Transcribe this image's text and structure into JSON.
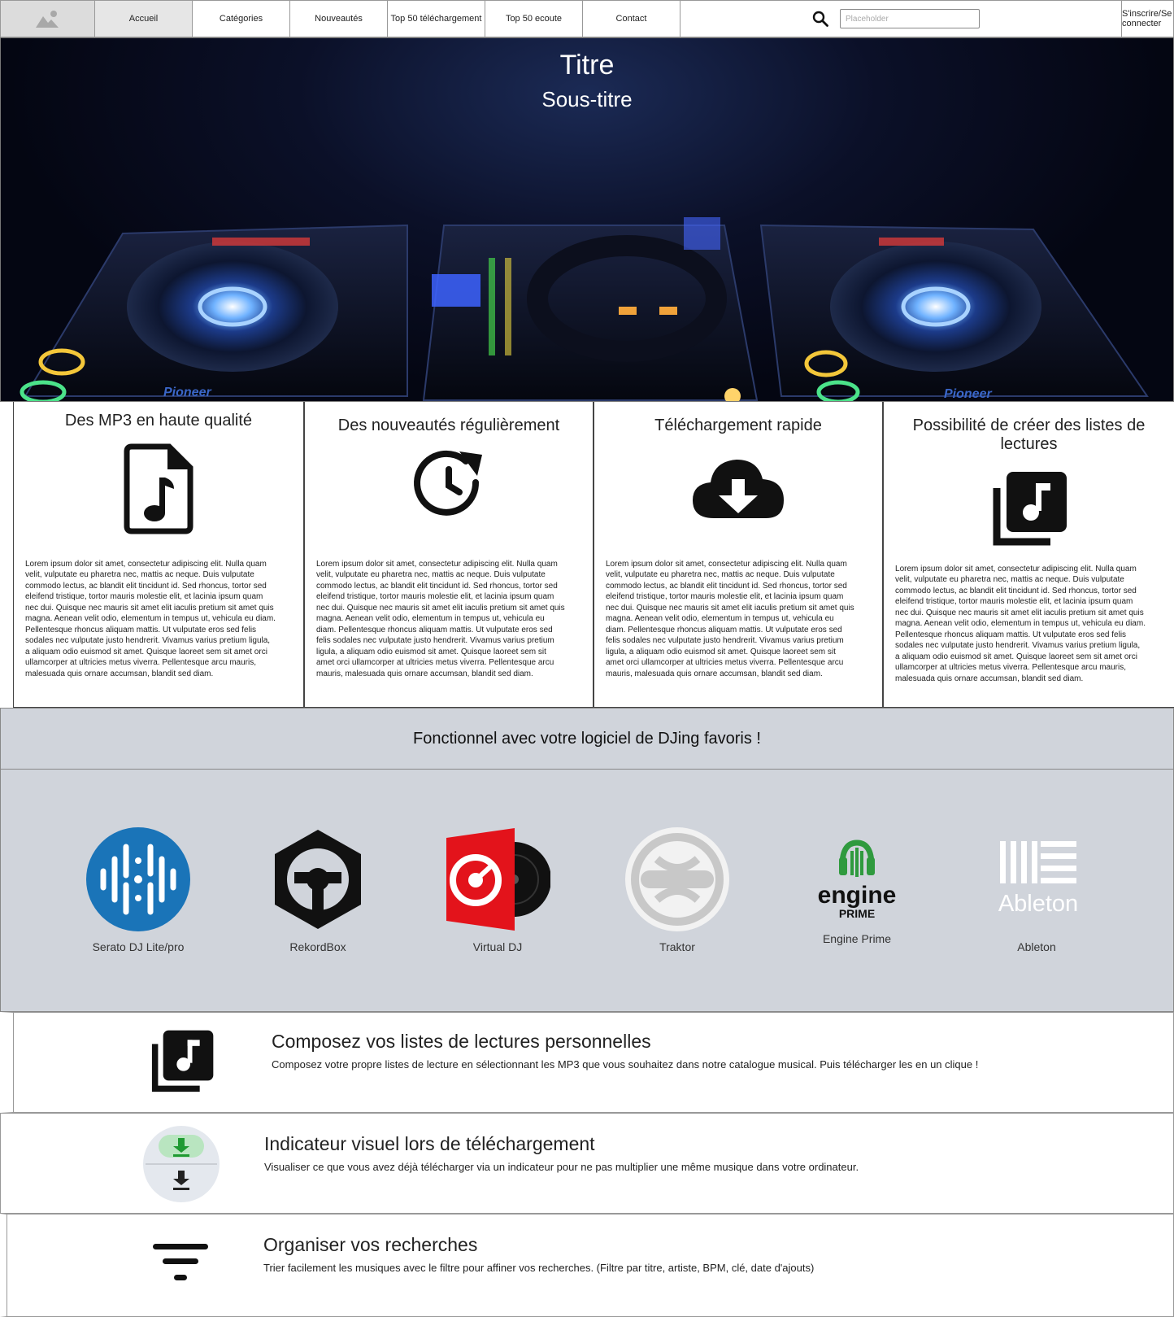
{
  "nav": {
    "tabs": [
      {
        "label": "Accueil",
        "active": true
      },
      {
        "label": "Catégories",
        "active": false
      },
      {
        "label": "Nouveautés",
        "active": false
      },
      {
        "label": "Top 50 téléchargement",
        "active": false
      },
      {
        "label": "Top 50 ecoute",
        "active": false
      },
      {
        "label": "Contact",
        "active": false
      }
    ],
    "search_placeholder": "Placeholder",
    "auth_label": "S'inscrire/Se connecter"
  },
  "hero": {
    "title": "Titre",
    "subtitle": "Sous-titre",
    "deck_labels": {
      "left": "Pioneer",
      "right": "Pioneer"
    }
  },
  "features": [
    {
      "title": "Des MP3 en haute qualité",
      "icon": "music-file-icon",
      "text": "Lorem ipsum dolor sit amet, consectetur adipiscing elit. Nulla quam velit, vulputate eu pharetra nec, mattis ac neque. Duis vulputate commodo lectus, ac blandit elit tincidunt id. Sed rhoncus, tortor sed eleifend tristique, tortor mauris molestie elit, et lacinia ipsum quam nec dui. Quisque nec mauris sit amet elit iaculis pretium sit amet quis magna. Aenean velit odio, elementum in tempus ut, vehicula eu diam. Pellentesque rhoncus aliquam mattis. Ut vulputate eros sed felis sodales nec vulputate justo hendrerit. Vivamus varius pretium ligula, a aliquam odio euismod sit amet. Quisque laoreet sem sit amet orci ullamcorper at ultricies metus viverra. Pellentesque arcu mauris, malesuada quis ornare accumsan, blandit sed diam."
    },
    {
      "title": "Des nouveautés régulièrement",
      "icon": "clock-refresh-icon",
      "text": "Lorem ipsum dolor sit amet, consectetur adipiscing elit. Nulla quam velit, vulputate eu pharetra nec, mattis ac neque. Duis vulputate commodo lectus, ac blandit elit tincidunt id. Sed rhoncus, tortor sed eleifend tristique, tortor mauris molestie elit, et lacinia ipsum quam nec dui. Quisque nec mauris sit amet elit iaculis pretium sit amet quis magna. Aenean velit odio, elementum in tempus ut, vehicula eu diam. Pellentesque rhoncus aliquam mattis. Ut vulputate eros sed felis sodales nec vulputate justo hendrerit. Vivamus varius pretium ligula, a aliquam odio euismod sit amet. Quisque laoreet sem sit amet orci ullamcorper at ultricies metus viverra. Pellentesque arcu mauris, malesuada quis ornare accumsan, blandit sed diam."
    },
    {
      "title": "Téléchargement rapide",
      "icon": "cloud-download-icon",
      "text": "Lorem ipsum dolor sit amet, consectetur adipiscing elit. Nulla quam velit, vulputate eu pharetra nec, mattis ac neque. Duis vulputate commodo lectus, ac blandit elit tincidunt id. Sed rhoncus, tortor sed eleifend tristique, tortor mauris molestie elit, et lacinia ipsum quam nec dui. Quisque nec mauris sit amet elit iaculis pretium sit amet quis magna. Aenean velit odio, elementum in tempus ut, vehicula eu diam. Pellentesque rhoncus aliquam mattis. Ut vulputate eros sed felis sodales nec vulputate justo hendrerit. Vivamus varius pretium ligula, a aliquam odio euismod sit amet. Quisque laoreet sem sit amet orci ullamcorper at ultricies metus viverra. Pellentesque arcu mauris, malesuada quis ornare accumsan, blandit sed diam."
    },
    {
      "title": "Possibilité de créer des listes de lectures",
      "icon": "music-library-icon",
      "text": "Lorem ipsum dolor sit amet, consectetur adipiscing elit. Nulla quam velit, vulputate eu pharetra nec, mattis ac neque. Duis vulputate commodo lectus, ac blandit elit tincidunt id. Sed rhoncus, tortor sed eleifend tristique, tortor mauris molestie elit, et lacinia ipsum quam nec dui. Quisque nec mauris sit amet elit iaculis pretium sit amet quis magna. Aenean velit odio, elementum in tempus ut, vehicula eu diam. Pellentesque rhoncus aliquam mattis. Ut vulputate eros sed felis sodales nec vulputate justo hendrerit. Vivamus varius pretium ligula, a aliquam odio euismod sit amet. Quisque laoreet sem sit amet orci ullamcorper at ultricies metus viverra. Pellentesque arcu mauris, malesuada quis ornare accumsan, blandit sed diam."
    }
  ],
  "dj_section": {
    "heading": "Fonctionnel avec votre logiciel de DJing favoris !",
    "software": [
      {
        "name": "Serato DJ Lite/pro",
        "icon": "serato-logo-icon",
        "color": "#1a74b8"
      },
      {
        "name": "RekordBox",
        "icon": "rekordbox-logo-icon",
        "color": "#111111"
      },
      {
        "name": "Virtual DJ",
        "icon": "virtualdj-logo-icon",
        "color": "#e3131b"
      },
      {
        "name": "Traktor",
        "icon": "traktor-logo-icon",
        "color": "#bfbfbf"
      },
      {
        "name": "Engine Prime",
        "icon": "engine-prime-logo-icon",
        "color": "#2f9a3e",
        "logo_text": {
          "engine": "engine",
          "prime": "PRIME"
        }
      },
      {
        "name": "Ableton",
        "icon": "ableton-logo-icon",
        "color": "#ffffff",
        "logo_text": "Ableton"
      }
    ]
  },
  "rows": [
    {
      "title": "Composez vos listes de lectures personnelles",
      "icon": "music-library-icon",
      "text": "Composez votre propre listes de lecture en sélectionnant les MP3 que vous souhaitez dans notre catalogue musical. Puis télécharger les en un clique !"
    },
    {
      "title": "Indicateur visuel lors de téléchargement",
      "icon": "download-indicator-icon",
      "text": "Visualiser ce que vous avez déjà télécharger via un indicateur pour ne pas multiplier une même musique dans votre ordinateur."
    },
    {
      "title": "Organiser vos recherches",
      "icon": "filter-icon",
      "text": "Trier facilement les musiques avec le filtre pour affiner vos recherches. (Filtre par titre, artiste, BPM, clé, date d'ajouts)"
    }
  ],
  "colors": {
    "nav_active": "#e6e6e6",
    "dj_band": "#d0d4db",
    "download_green": "#1f9a32"
  }
}
